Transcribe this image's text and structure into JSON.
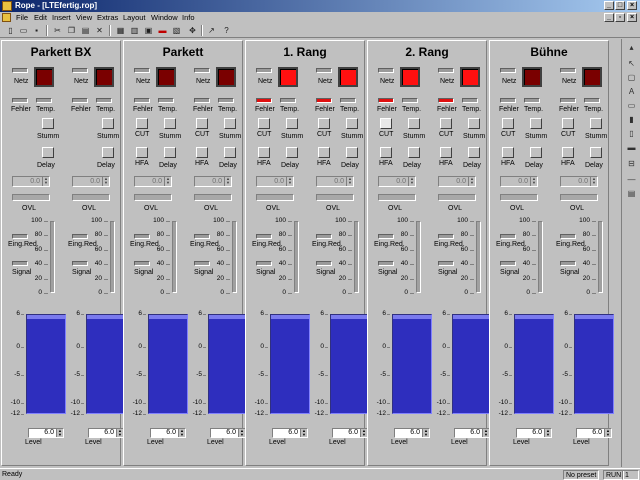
{
  "window": {
    "title": "Rope - [LTEfertig.rop]",
    "min": "_",
    "max": "□",
    "close": "×"
  },
  "menu": [
    "File",
    "Edit",
    "Insert",
    "View",
    "Extras",
    "Layout",
    "Window",
    "Info"
  ],
  "toolbar_icons": [
    "new-icon",
    "open-icon",
    "save-icon",
    "cut-icon",
    "copy-icon",
    "paste-icon",
    "delete-icon",
    "grid-icon",
    "layout-icon",
    "panel-icon",
    "split-icon",
    "align-icon",
    "fit-icon",
    "zoom-icon",
    "help-icon"
  ],
  "labels": {
    "netz": "Netz",
    "fehler": "Fehler",
    "temp": "Temp.",
    "stumm": "Stumm",
    "delay": "Delay",
    "cut": "CUT",
    "hfa": "HFA",
    "ovl": "OVL",
    "eingred": "Eing.Red.",
    "signal": "Signal",
    "level": "Level"
  },
  "spin_value": "0.0",
  "level_value": "6.0",
  "scale_ticks": [
    "100",
    "80",
    "60",
    "40",
    "20",
    "0"
  ],
  "meter_ticks": [
    "6",
    "0",
    "-5",
    "-10",
    "-12"
  ],
  "meter_level": 0.96,
  "colors": {
    "led_dark": "#7a0000",
    "led_bright": "#ff1010",
    "meter": "#3232c8"
  },
  "sections": [
    {
      "title": "Parkett BX",
      "led": [
        "dark",
        "dark"
      ],
      "fehler_red": [
        false,
        false
      ],
      "cut": false
    },
    {
      "title": "Parkett",
      "led": [
        "dark",
        "dark"
      ],
      "fehler_red": [
        false,
        false
      ],
      "cut": true
    },
    {
      "title": "1. Rang",
      "led": [
        "bright",
        "bright"
      ],
      "fehler_red": [
        true,
        true
      ],
      "cut": true
    },
    {
      "title": "2. Rang",
      "led": [
        "bright",
        "bright"
      ],
      "fehler_red": [
        true,
        true
      ],
      "cut": true
    },
    {
      "title": "Bühne",
      "led": [
        "dark",
        "dark"
      ],
      "fehler_red": [
        false,
        false
      ],
      "cut": true
    }
  ],
  "status": {
    "ready": "Ready",
    "preset": "No preset",
    "run": "RUN",
    "num": "1"
  }
}
